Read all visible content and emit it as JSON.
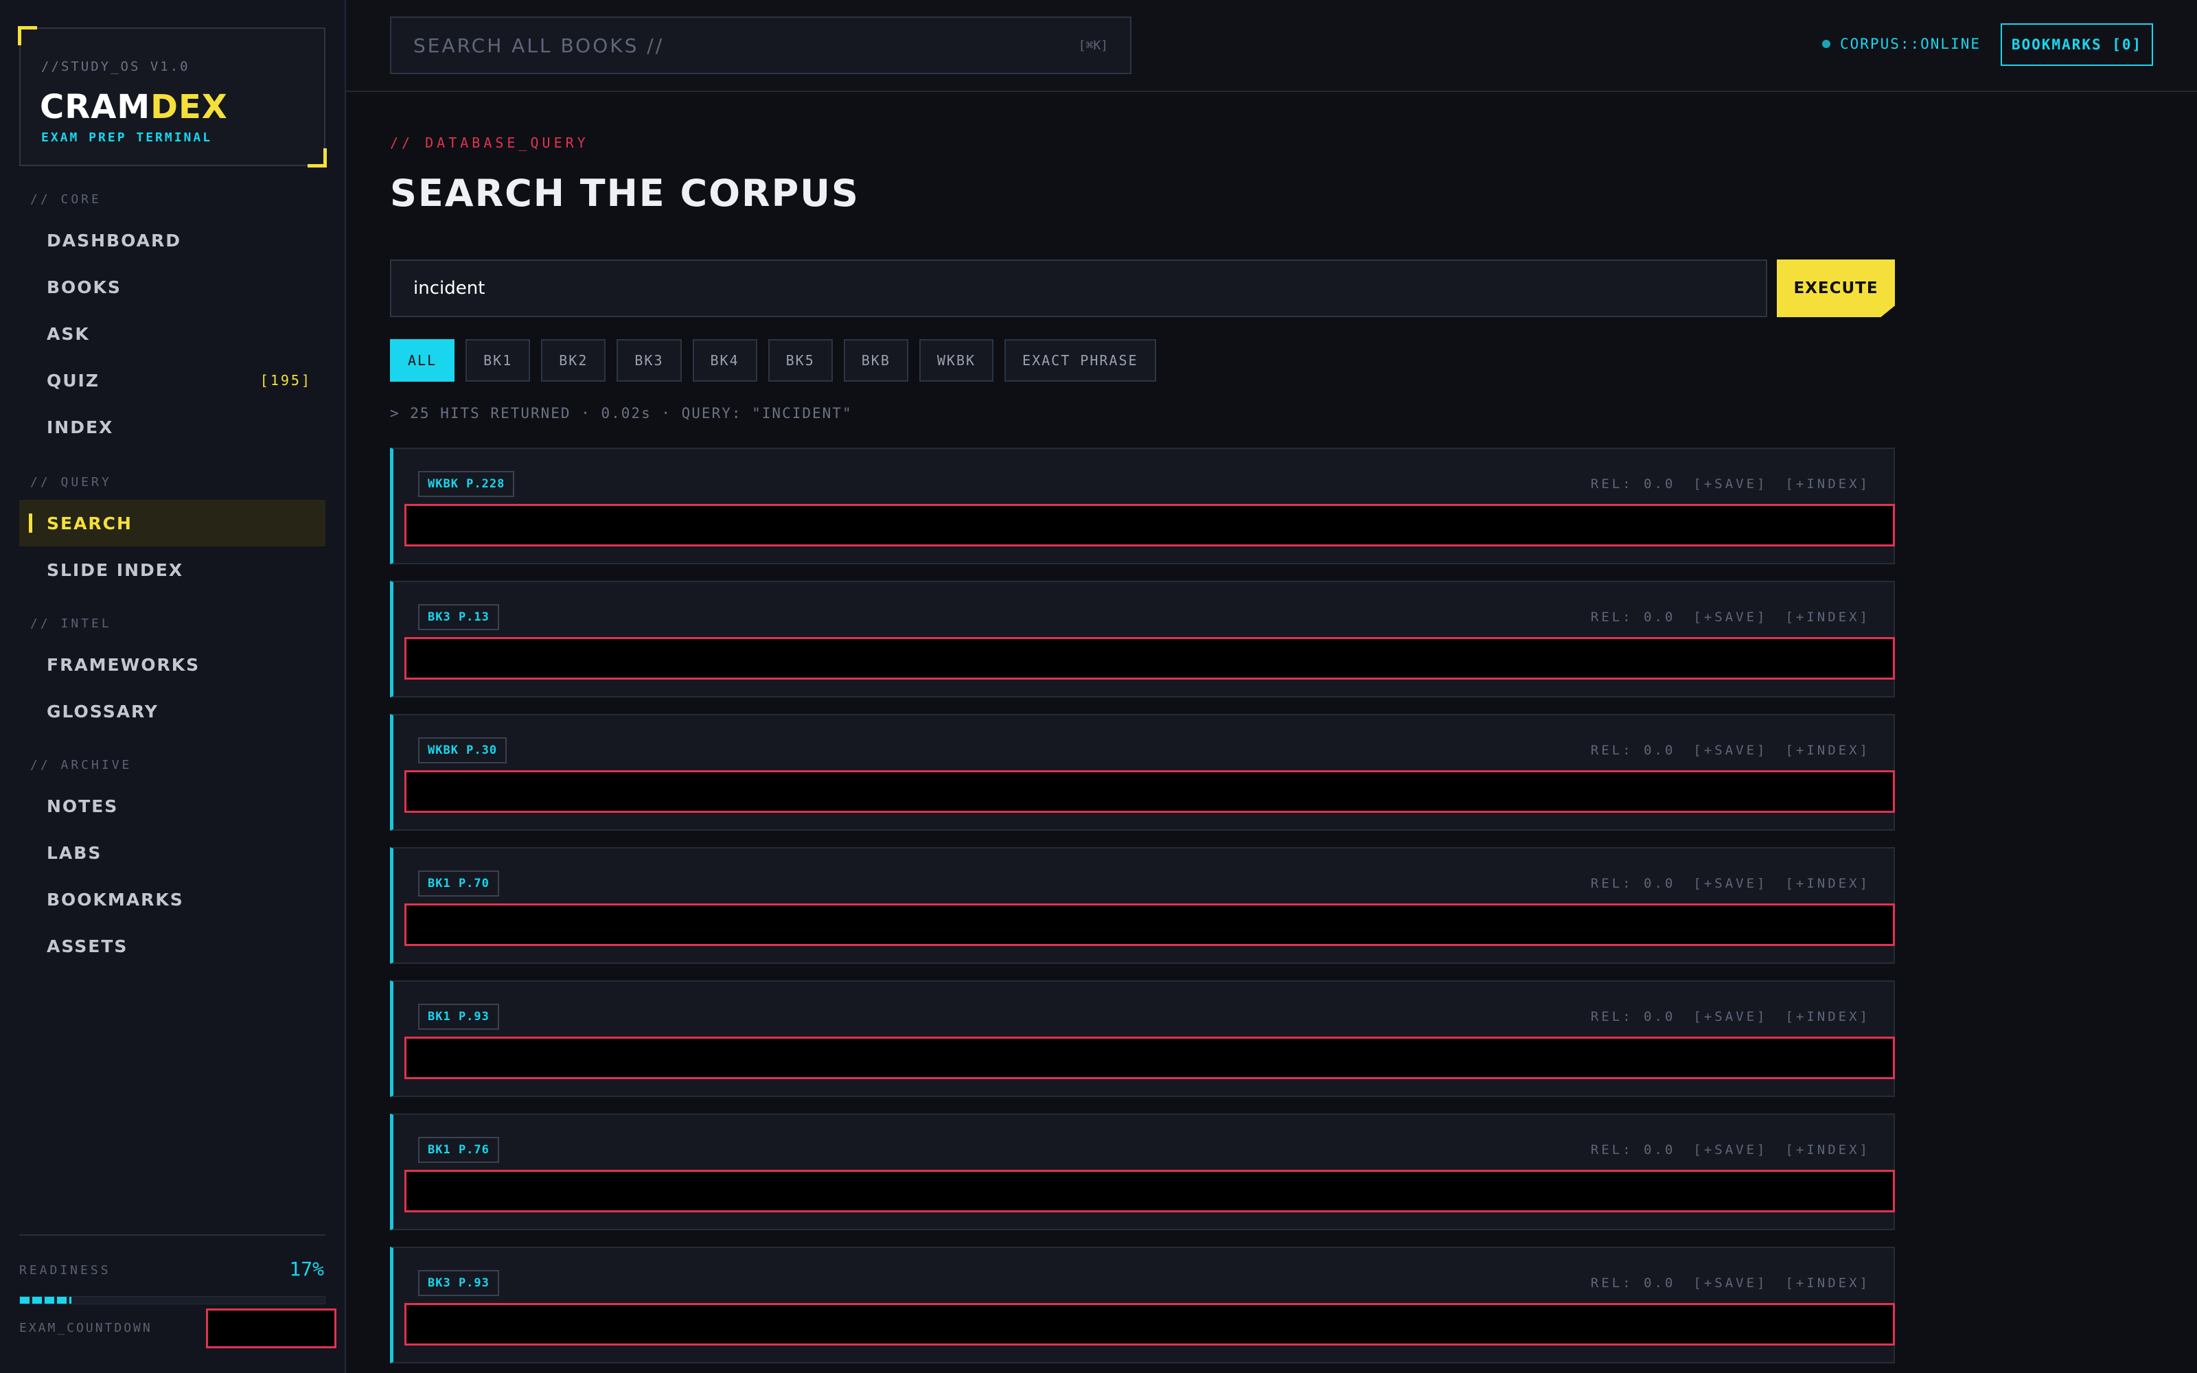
{
  "app": {
    "version": "//STUDY_OS V1.0",
    "title_part1": "CRAM",
    "title_part2": "DEX",
    "subtitle": "EXAM PREP TERMINAL",
    "accent_color": "#f5e03b",
    "cyan_color": "#19d6ee",
    "alert_color": "#e2334f"
  },
  "sidebar": {
    "sections": [
      {
        "label": "// CORE"
      },
      {
        "label": "// QUERY"
      },
      {
        "label": "// INTEL"
      },
      {
        "label": "// ARCHIVE"
      }
    ],
    "items": [
      {
        "label": "DASHBOARD"
      },
      {
        "label": "BOOKS"
      },
      {
        "label": "ASK"
      },
      {
        "label": "QUIZ",
        "badge": "[195]"
      },
      {
        "label": "INDEX"
      },
      {
        "label": "SEARCH",
        "active": true
      },
      {
        "label": "SLIDE INDEX"
      },
      {
        "label": "FRAMEWORKS"
      },
      {
        "label": "GLOSSARY"
      },
      {
        "label": "NOTES"
      },
      {
        "label": "LABS"
      },
      {
        "label": "BOOKMARKS"
      },
      {
        "label": "ASSETS"
      }
    ],
    "readiness_label": "READINESS",
    "readiness_value": "17%",
    "readiness_fraction": 0.17,
    "countdown_label": "EXAM_COUNTDOWN"
  },
  "topbar": {
    "search_placeholder": "SEARCH ALL BOOKS //",
    "search_shortcut": "[⌘K]",
    "status": "CORPUS::ONLINE",
    "bookmarks_label": "BOOKMARKS [0]"
  },
  "main": {
    "eyebrow": "// DATABASE_QUERY",
    "title": "SEARCH THE CORPUS",
    "query_value": "incident",
    "execute_label": "EXECUTE",
    "filters": [
      "ALL",
      "BK1",
      "BK2",
      "BK3",
      "BK4",
      "BK5",
      "BKB",
      "WKBK",
      "EXACT PHRASE"
    ],
    "hits_meta": "> 25 HITS RETURNED · 0.02s · QUERY: \"INCIDENT\"",
    "results": [
      {
        "tag": "WKBK P.228",
        "rel": "REL: 0.0",
        "save": "[+SAVE]",
        "index": "[+INDEX]"
      },
      {
        "tag": "BK3 P.13",
        "rel": "REL: 0.0",
        "save": "[+SAVE]",
        "index": "[+INDEX]"
      },
      {
        "tag": "WKBK P.30",
        "rel": "REL: 0.0",
        "save": "[+SAVE]",
        "index": "[+INDEX]"
      },
      {
        "tag": "BK1 P.70",
        "rel": "REL: 0.0",
        "save": "[+SAVE]",
        "index": "[+INDEX]"
      },
      {
        "tag": "BK1 P.93",
        "rel": "REL: 0.0",
        "save": "[+SAVE]",
        "index": "[+INDEX]"
      },
      {
        "tag": "BK1 P.76",
        "rel": "REL: 0.0",
        "save": "[+SAVE]",
        "index": "[+INDEX]"
      },
      {
        "tag": "BK3 P.93",
        "rel": "REL: 0.0",
        "save": "[+SAVE]",
        "index": "[+INDEX]"
      }
    ]
  }
}
